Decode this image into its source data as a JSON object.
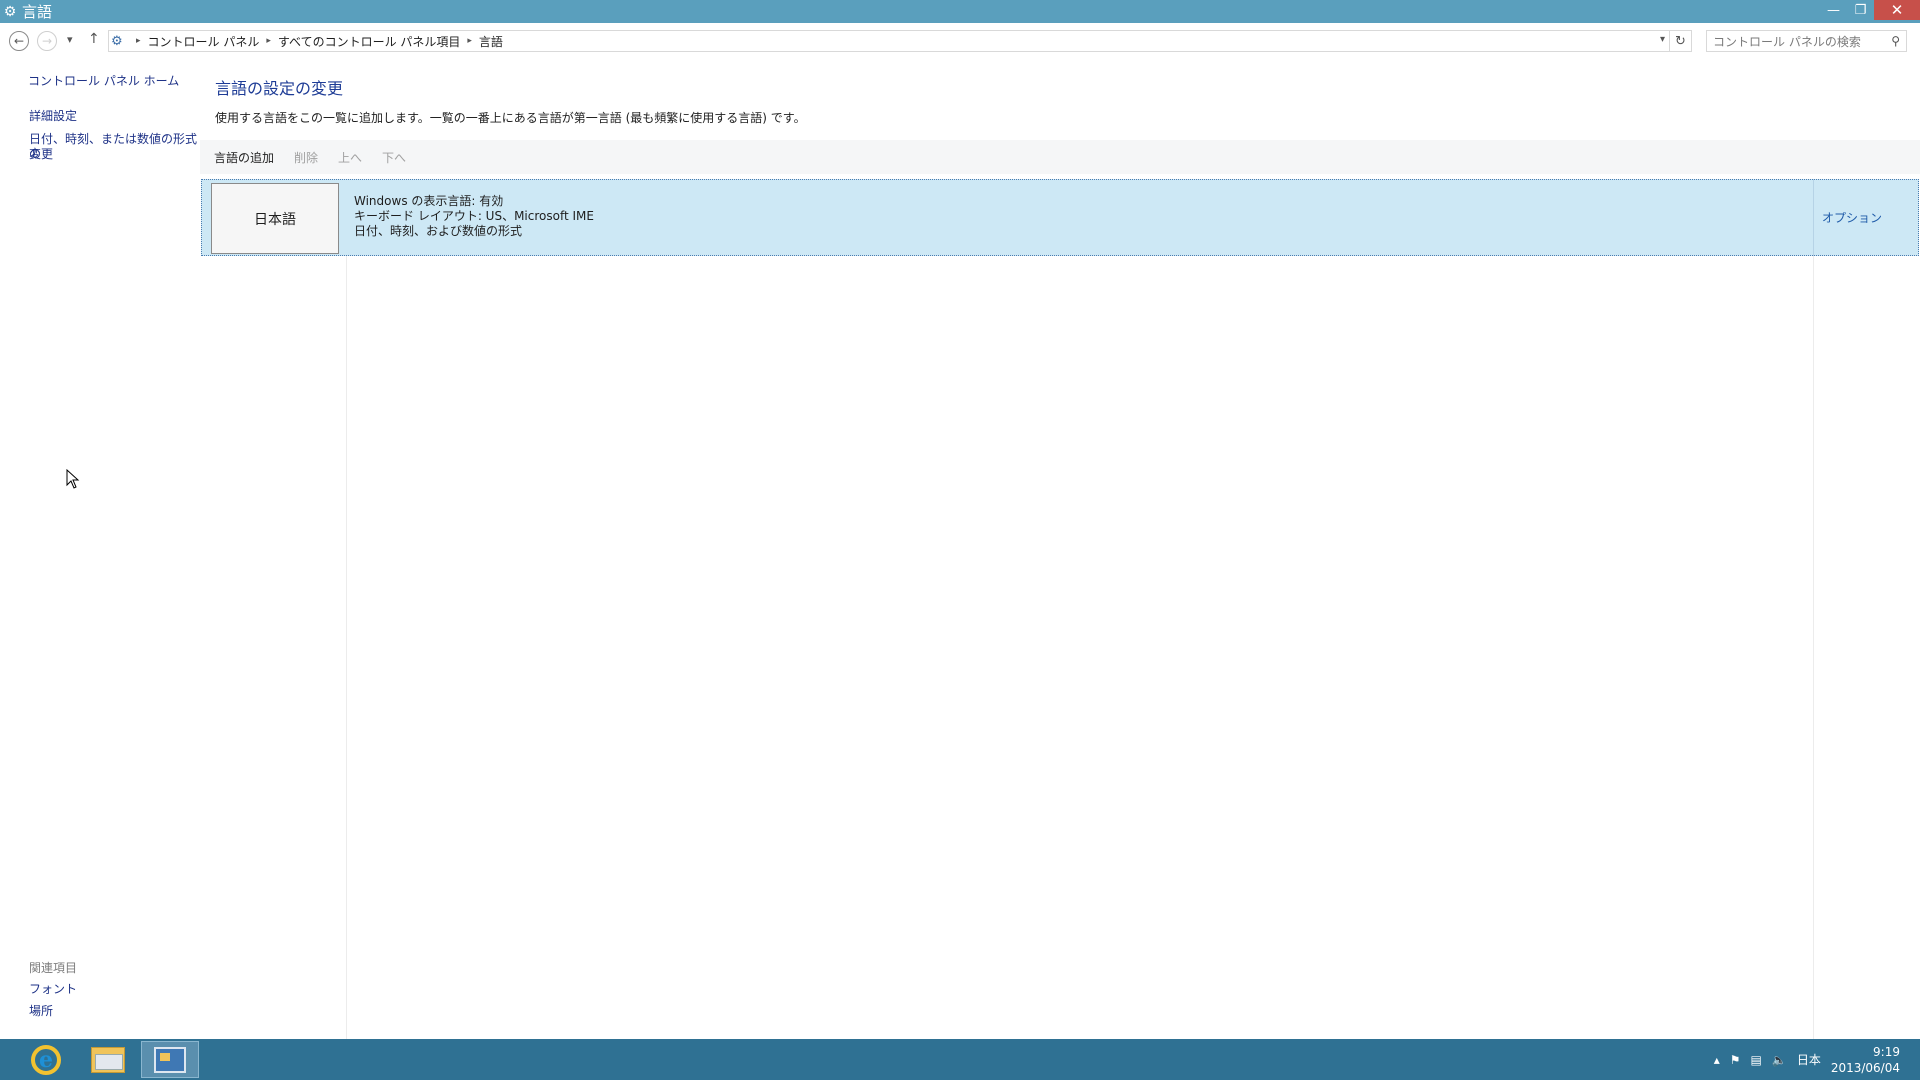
{
  "window": {
    "title": "言語",
    "icon": "control-panel-icon"
  },
  "address_bar": {
    "breadcrumbs": [
      "コントロール パネル",
      "すべてのコントロール パネル項目",
      "言語"
    ],
    "search_placeholder": "コントロール パネルの検索"
  },
  "left_pane": {
    "home_link": "コントロール パネル ホーム",
    "links": [
      "詳細設定",
      "日付、時刻、または数値の形式の",
      "変更"
    ],
    "related_heading": "関連項目",
    "related_links": [
      "フォント",
      "場所"
    ]
  },
  "main": {
    "heading": "言語の設定の変更",
    "description": "使用する言語をこの一覧に追加します。一覧の一番上にある言語が第一言語 (最も頻繁に使用する言語) です。",
    "toolbar": {
      "add": "言語の追加",
      "remove": "削除",
      "up": "上へ",
      "down": "下へ"
    },
    "languages": [
      {
        "name": "日本語",
        "details": [
          "Windows の表示言語: 有効",
          "キーボード レイアウト: US、Microsoft IME",
          "日付、時刻、および数値の形式"
        ],
        "options_link": "オプション"
      }
    ]
  },
  "taskbar": {
    "tray_language": "日本",
    "time": "9:19",
    "date": "2013/06/04",
    "pinned": [
      "internet-explorer-icon",
      "file-explorer-icon",
      "control-panel-icon"
    ]
  },
  "colors": {
    "titlebar": "#5a9fbd",
    "taskbar": "#2f7193",
    "selection": "#cde8f5",
    "link": "#1e3287"
  }
}
